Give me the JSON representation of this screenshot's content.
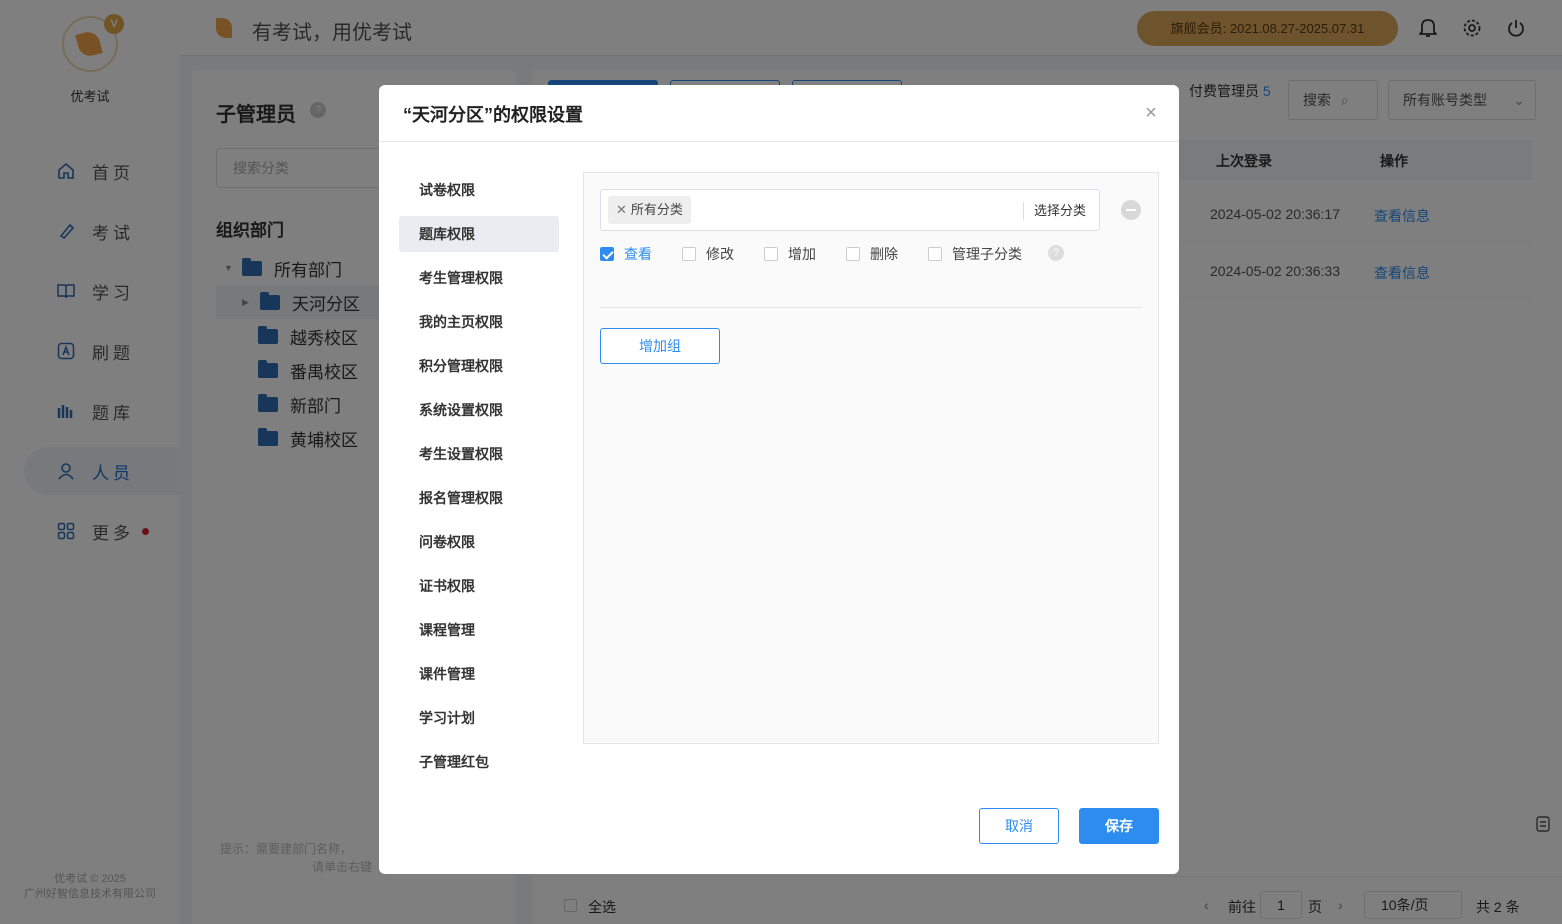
{
  "app": {
    "name": "优考试",
    "slogan": "有考试，用优考试",
    "vip_badge": "旗舰会员: 2021.08.27-2025.07.31",
    "copyright_line1": "优考试 © 2025",
    "copyright_line2": "广州好智信息技术有限公司"
  },
  "nav": {
    "items": [
      {
        "label": "首页",
        "icon": "home-icon"
      },
      {
        "label": "考试",
        "icon": "exam-icon"
      },
      {
        "label": "学习",
        "icon": "book-icon"
      },
      {
        "label": "刷题",
        "icon": "practice-icon"
      },
      {
        "label": "题库",
        "icon": "question-bank-icon"
      },
      {
        "label": "人员",
        "icon": "person-icon"
      },
      {
        "label": "更多",
        "icon": "more-icon"
      }
    ],
    "active": "人员"
  },
  "left_panel": {
    "title": "子管理员",
    "search_placeholder": "搜索分类",
    "section": "组织部门",
    "tree": [
      "所有部门",
      "天河分区",
      "越秀校区",
      "番禺校区",
      "新部门",
      "黄埔校区"
    ],
    "hint_line1": "提示：需要建部门名称，",
    "hint_line2": "请单击右键"
  },
  "right_panel": {
    "paid_admin_label": "付费管理员",
    "paid_admin_count": "5",
    "search_label": "搜索",
    "account_type": "所有账号类型",
    "col_last_login": "上次登录",
    "col_action": "操作",
    "rows": [
      {
        "last_login": "2024-05-02 20:36:17",
        "action": "查看信息"
      },
      {
        "last_login": "2024-05-02 20:36:33",
        "action": "查看信息"
      }
    ],
    "footer": {
      "select_all": "全选",
      "goto": "前往",
      "page": "1",
      "page_unit": "页",
      "page_size": "10条/页",
      "total": "共 2 条"
    }
  },
  "dialog": {
    "title": "“天河分区”的权限设置",
    "tabs": [
      "试卷权限",
      "题库权限",
      "考生管理权限",
      "我的主页权限",
      "积分管理权限",
      "系统设置权限",
      "考生设置权限",
      "报名管理权限",
      "问卷权限",
      "证书权限",
      "课程管理",
      "课件管理",
      "学习计划",
      "子管理红包"
    ],
    "active_tab": "题库权限",
    "category_tag": "所有分类",
    "choose_category": "选择分类",
    "permissions": [
      {
        "label": "查看",
        "checked": true
      },
      {
        "label": "修改",
        "checked": false
      },
      {
        "label": "增加",
        "checked": false
      },
      {
        "label": "删除",
        "checked": false
      },
      {
        "label": "管理子分类",
        "checked": false
      }
    ],
    "add_group": "增加组",
    "cancel": "取消",
    "save": "保存"
  }
}
